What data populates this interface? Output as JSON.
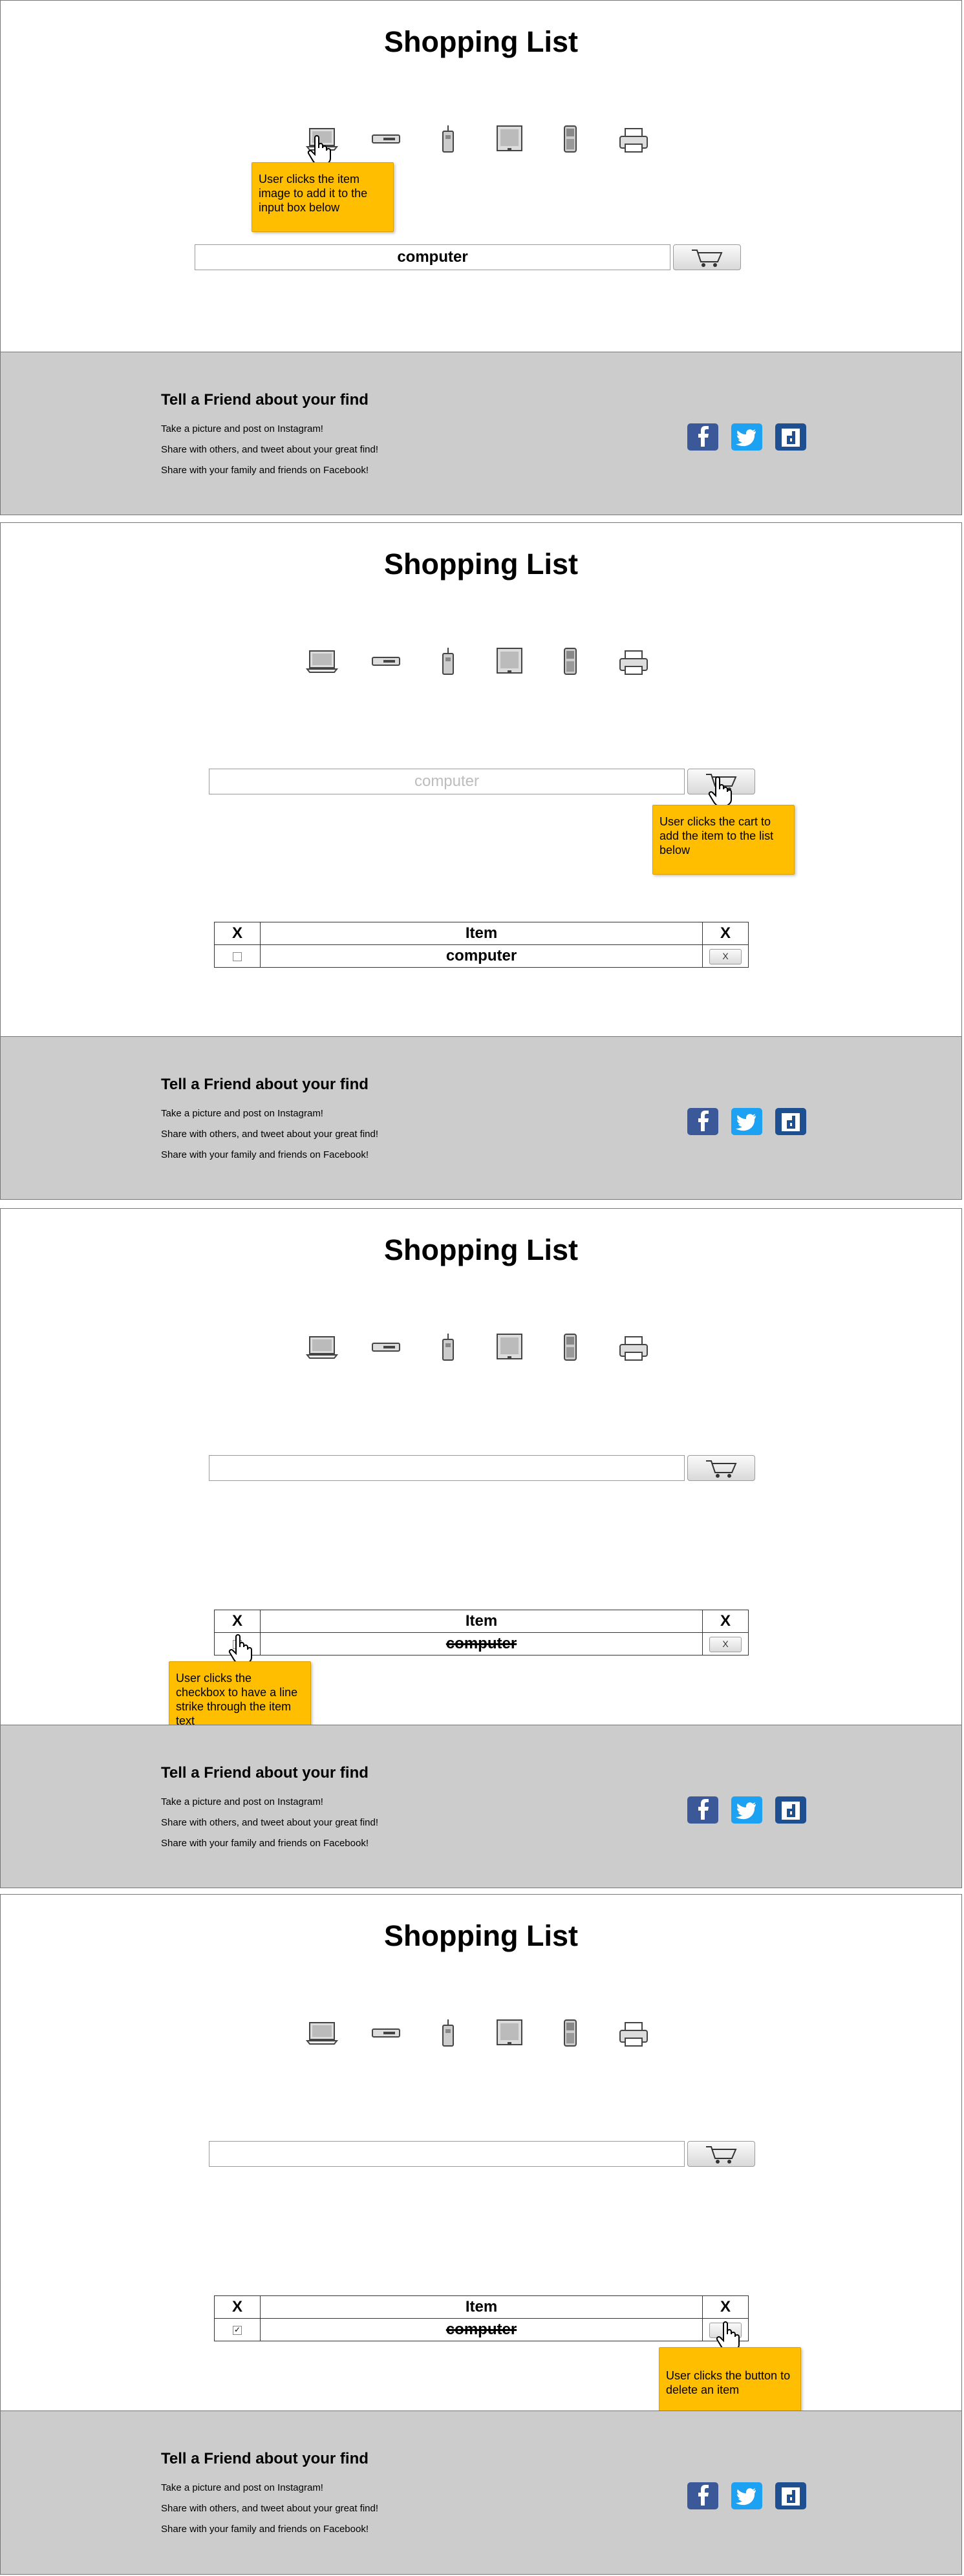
{
  "title": "Shopping List",
  "icons": [
    "laptop-icon",
    "dvd-player-icon",
    "phone-icon",
    "monitor-icon",
    "mobile-phone-icon",
    "printer-icon"
  ],
  "colors": {
    "note": "#ffbf00",
    "footer": "#cccccc",
    "facebook": "#3b5998",
    "twitter": "#1da1f2",
    "digg": "#1d4f91"
  },
  "item_text": "computer",
  "footer": {
    "heading": "Tell a Friend about your find",
    "line1": "Take a picture and post on Instagram!",
    "line2": "Share with others, and tweet about your great find!",
    "line3": "Share with your family and friends on Facebook!"
  },
  "table": {
    "col_x": "X",
    "col_item": "Item",
    "col_delete": "X",
    "delete_label": "X"
  },
  "notes": {
    "step1": "User clicks the item image to add it to the input box below",
    "step2": "User clicks the cart to add the item to the list below",
    "step3": "User clicks the checkbox to have a line strike through the item text",
    "step4": "User clicks the button to delete an item"
  }
}
